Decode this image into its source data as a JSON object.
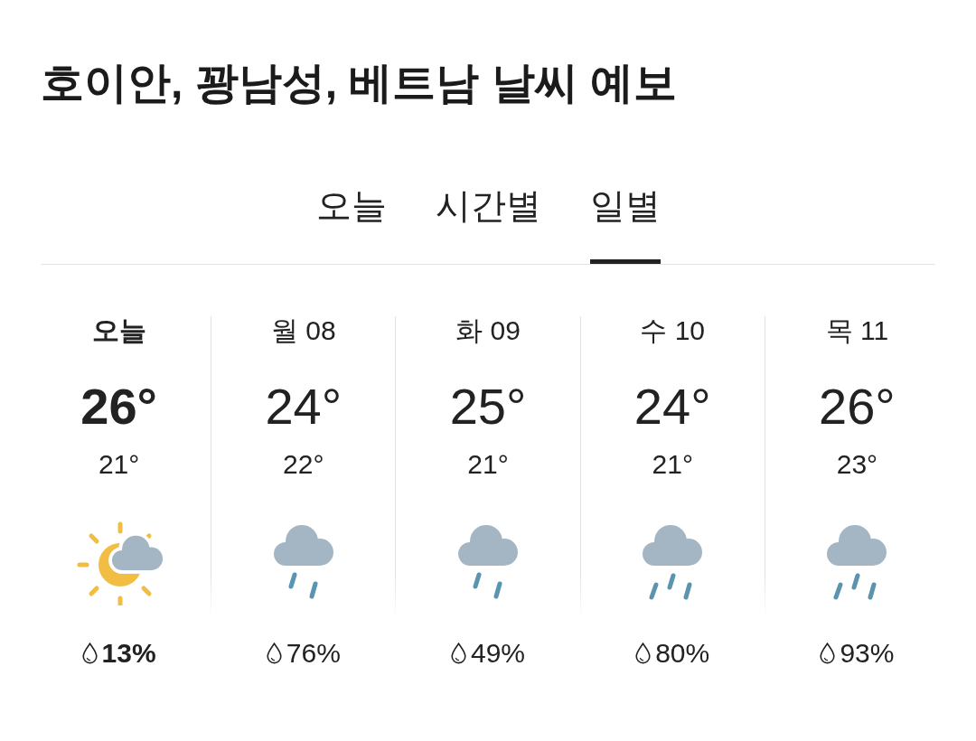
{
  "title": "호이안, 꽝남성, 베트남 날씨 예보",
  "tabs": [
    {
      "label": "오늘",
      "selected": false
    },
    {
      "label": "시간별",
      "selected": false
    },
    {
      "label": "일별",
      "selected": true
    }
  ],
  "days": [
    {
      "label": "오늘",
      "high": "26°",
      "low": "21°",
      "kind": "partly",
      "precip": "13%",
      "selected": true
    },
    {
      "label": "월 08",
      "high": "24°",
      "low": "22°",
      "kind": "drizzle",
      "precip": "76%",
      "selected": false
    },
    {
      "label": "화 09",
      "high": "25°",
      "low": "21°",
      "kind": "drizzle",
      "precip": "49%",
      "selected": false
    },
    {
      "label": "수 10",
      "high": "24°",
      "low": "21°",
      "kind": "rain",
      "precip": "80%",
      "selected": false
    },
    {
      "label": "목 11",
      "high": "26°",
      "low": "23°",
      "kind": "rain",
      "precip": "93%",
      "selected": false
    }
  ]
}
